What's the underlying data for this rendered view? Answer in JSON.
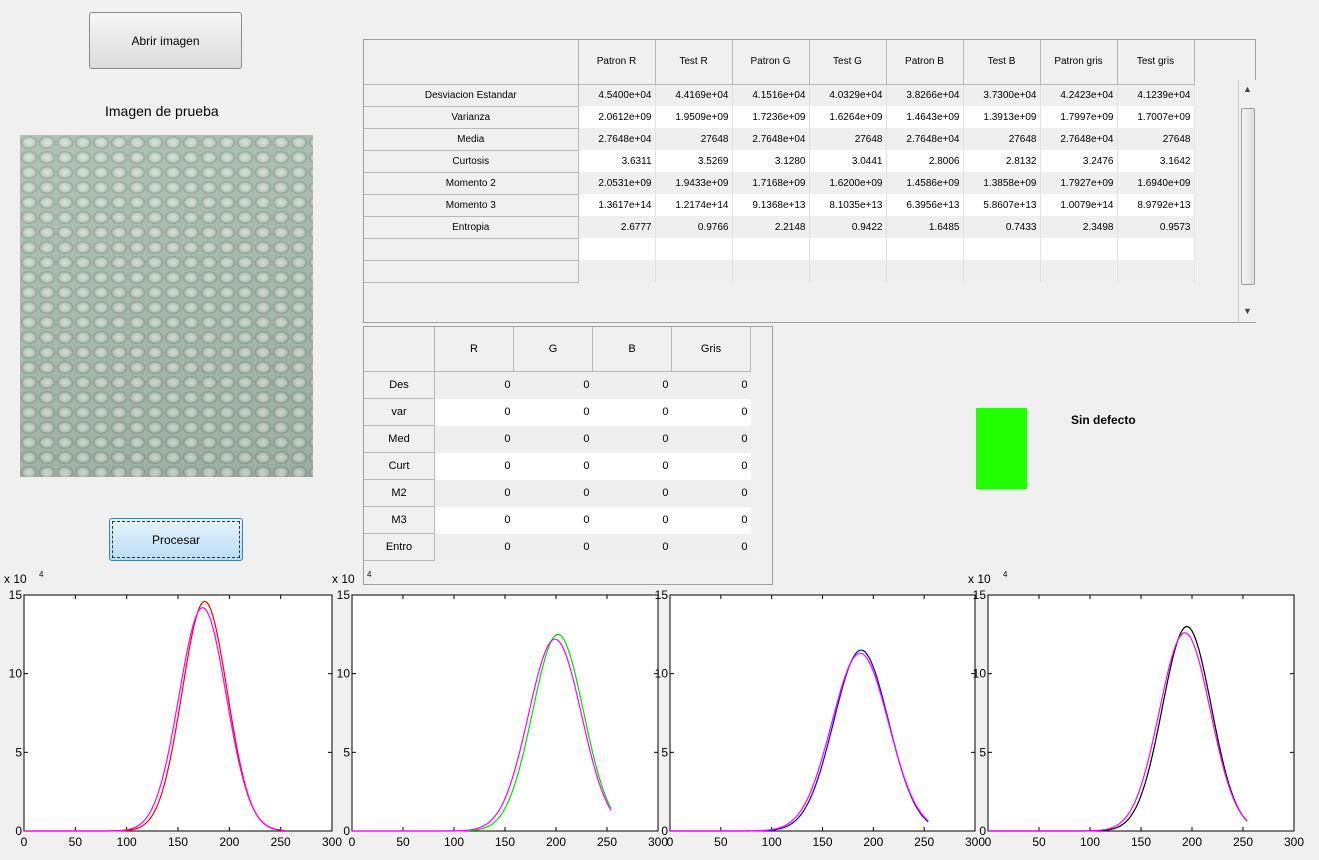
{
  "buttons": {
    "open_image": "Abrir imagen",
    "process": "Procesar"
  },
  "image_label": "Imagen de prueba",
  "stats_table": {
    "columns": [
      "Patron R",
      "Test R",
      "Patron G",
      "Test G",
      "Patron B",
      "Test B",
      "Patron gris",
      "Test gris"
    ],
    "rows": [
      {
        "label": "Desviacion Estandar",
        "values": [
          "4.5400e+04",
          "4.4169e+04",
          "4.1516e+04",
          "4.0329e+04",
          "3.8266e+04",
          "3.7300e+04",
          "4.2423e+04",
          "4.1239e+04"
        ]
      },
      {
        "label": "Varianza",
        "values": [
          "2.0612e+09",
          "1.9509e+09",
          "1.7236e+09",
          "1.6264e+09",
          "1.4643e+09",
          "1.3913e+09",
          "1.7997e+09",
          "1.7007e+09"
        ]
      },
      {
        "label": "Media",
        "values": [
          "2.7648e+04",
          "27648",
          "2.7648e+04",
          "27648",
          "2.7648e+04",
          "27648",
          "2.7648e+04",
          "27648"
        ]
      },
      {
        "label": "Curtosis",
        "values": [
          "3.6311",
          "3.5269",
          "3.1280",
          "3.0441",
          "2.8006",
          "2.8132",
          "3.2476",
          "3.1642"
        ]
      },
      {
        "label": "Momento 2",
        "values": [
          "2.0531e+09",
          "1.9433e+09",
          "1.7168e+09",
          "1.6200e+09",
          "1.4586e+09",
          "1.3858e+09",
          "1.7927e+09",
          "1.6940e+09"
        ]
      },
      {
        "label": "Momento 3",
        "values": [
          "1.3617e+14",
          "1.2174e+14",
          "9.1368e+13",
          "8.1035e+13",
          "6.3956e+13",
          "5.8607e+13",
          "1.0079e+14",
          "8.9792e+13"
        ]
      },
      {
        "label": "Entropia",
        "values": [
          "2.6777",
          "0.9766",
          "2.2148",
          "0.9422",
          "1.6485",
          "0.7433",
          "2.3498",
          "0.9573"
        ]
      },
      {
        "label": "",
        "values": [
          "",
          "",
          "",
          "",
          "",
          "",
          "",
          ""
        ]
      },
      {
        "label": "",
        "values": [
          "",
          "",
          "",
          "",
          "",
          "",
          "",
          ""
        ]
      }
    ]
  },
  "diff_table": {
    "columns": [
      "R",
      "G",
      "B",
      "Gris"
    ],
    "rows": [
      {
        "label": "Des",
        "values": [
          "0",
          "0",
          "0",
          "0"
        ]
      },
      {
        "label": "var",
        "values": [
          "0",
          "0",
          "0",
          "0"
        ]
      },
      {
        "label": "Med",
        "values": [
          "0",
          "0",
          "0",
          "0"
        ]
      },
      {
        "label": "Curt",
        "values": [
          "0",
          "0",
          "0",
          "0"
        ]
      },
      {
        "label": "M2",
        "values": [
          "0",
          "0",
          "0",
          "0"
        ]
      },
      {
        "label": "M3",
        "values": [
          "0",
          "0",
          "0",
          "0"
        ]
      },
      {
        "label": "Entro",
        "values": [
          "0",
          "0",
          "0",
          "0"
        ]
      }
    ]
  },
  "status": {
    "text": "Sin defecto",
    "color": "#22ff00"
  },
  "icons": {
    "scroll_up": "scroll-up-icon",
    "scroll_down": "scroll-down-icon"
  },
  "chart_data": [
    {
      "type": "line",
      "exponent_label": "x 10",
      "exponent": "4",
      "xlim": [
        0,
        300
      ],
      "ylim": [
        0,
        15
      ],
      "xticks": [
        "0",
        "50",
        "100",
        "150",
        "200",
        "250",
        "300"
      ],
      "yticks": [
        "0",
        "5",
        "10",
        "15"
      ],
      "series": [
        {
          "color": "#ff0000",
          "peak_x": 176,
          "peak_y": 14.6,
          "sigma": 22
        },
        {
          "color": "#ff00ff",
          "peak_x": 174,
          "peak_y": 14.2,
          "sigma": 23
        }
      ]
    },
    {
      "type": "line",
      "exponent_label": "x 10",
      "exponent": "4",
      "xlim": [
        0,
        300
      ],
      "ylim": [
        0,
        15
      ],
      "xticks": [
        "0",
        "50",
        "100",
        "150",
        "200",
        "250",
        "300"
      ],
      "yticks": [
        "0",
        "5",
        "10",
        "15"
      ],
      "series": [
        {
          "color": "#00dd00",
          "peak_x": 202,
          "peak_y": 12.5,
          "sigma": 25
        },
        {
          "color": "#ff00ff",
          "peak_x": 199,
          "peak_y": 12.2,
          "sigma": 26
        }
      ]
    },
    {
      "type": "line",
      "exponent_label": "",
      "exponent": "",
      "xlim": [
        0,
        300
      ],
      "ylim": [
        0,
        15
      ],
      "xticks": [
        "0",
        "50",
        "100",
        "150",
        "200",
        "250",
        "300"
      ],
      "yticks": [
        "0",
        "5",
        "10",
        "15"
      ],
      "series": [
        {
          "color": "#0000ff",
          "peak_x": 188,
          "peak_y": 11.5,
          "sigma": 27
        },
        {
          "color": "#ff00ff",
          "peak_x": 187,
          "peak_y": 11.3,
          "sigma": 28
        }
      ]
    },
    {
      "type": "line",
      "exponent_label": "x 10",
      "exponent": "4",
      "xlim": [
        0,
        300
      ],
      "ylim": [
        0,
        15
      ],
      "xticks": [
        "0",
        "50",
        "100",
        "150",
        "200",
        "250",
        "300"
      ],
      "yticks": [
        "0",
        "5",
        "10",
        "15"
      ],
      "series": [
        {
          "color": "#000000",
          "peak_x": 195,
          "peak_y": 13.0,
          "sigma": 24
        },
        {
          "color": "#ff00ff",
          "peak_x": 193,
          "peak_y": 12.6,
          "sigma": 25
        }
      ]
    }
  ]
}
